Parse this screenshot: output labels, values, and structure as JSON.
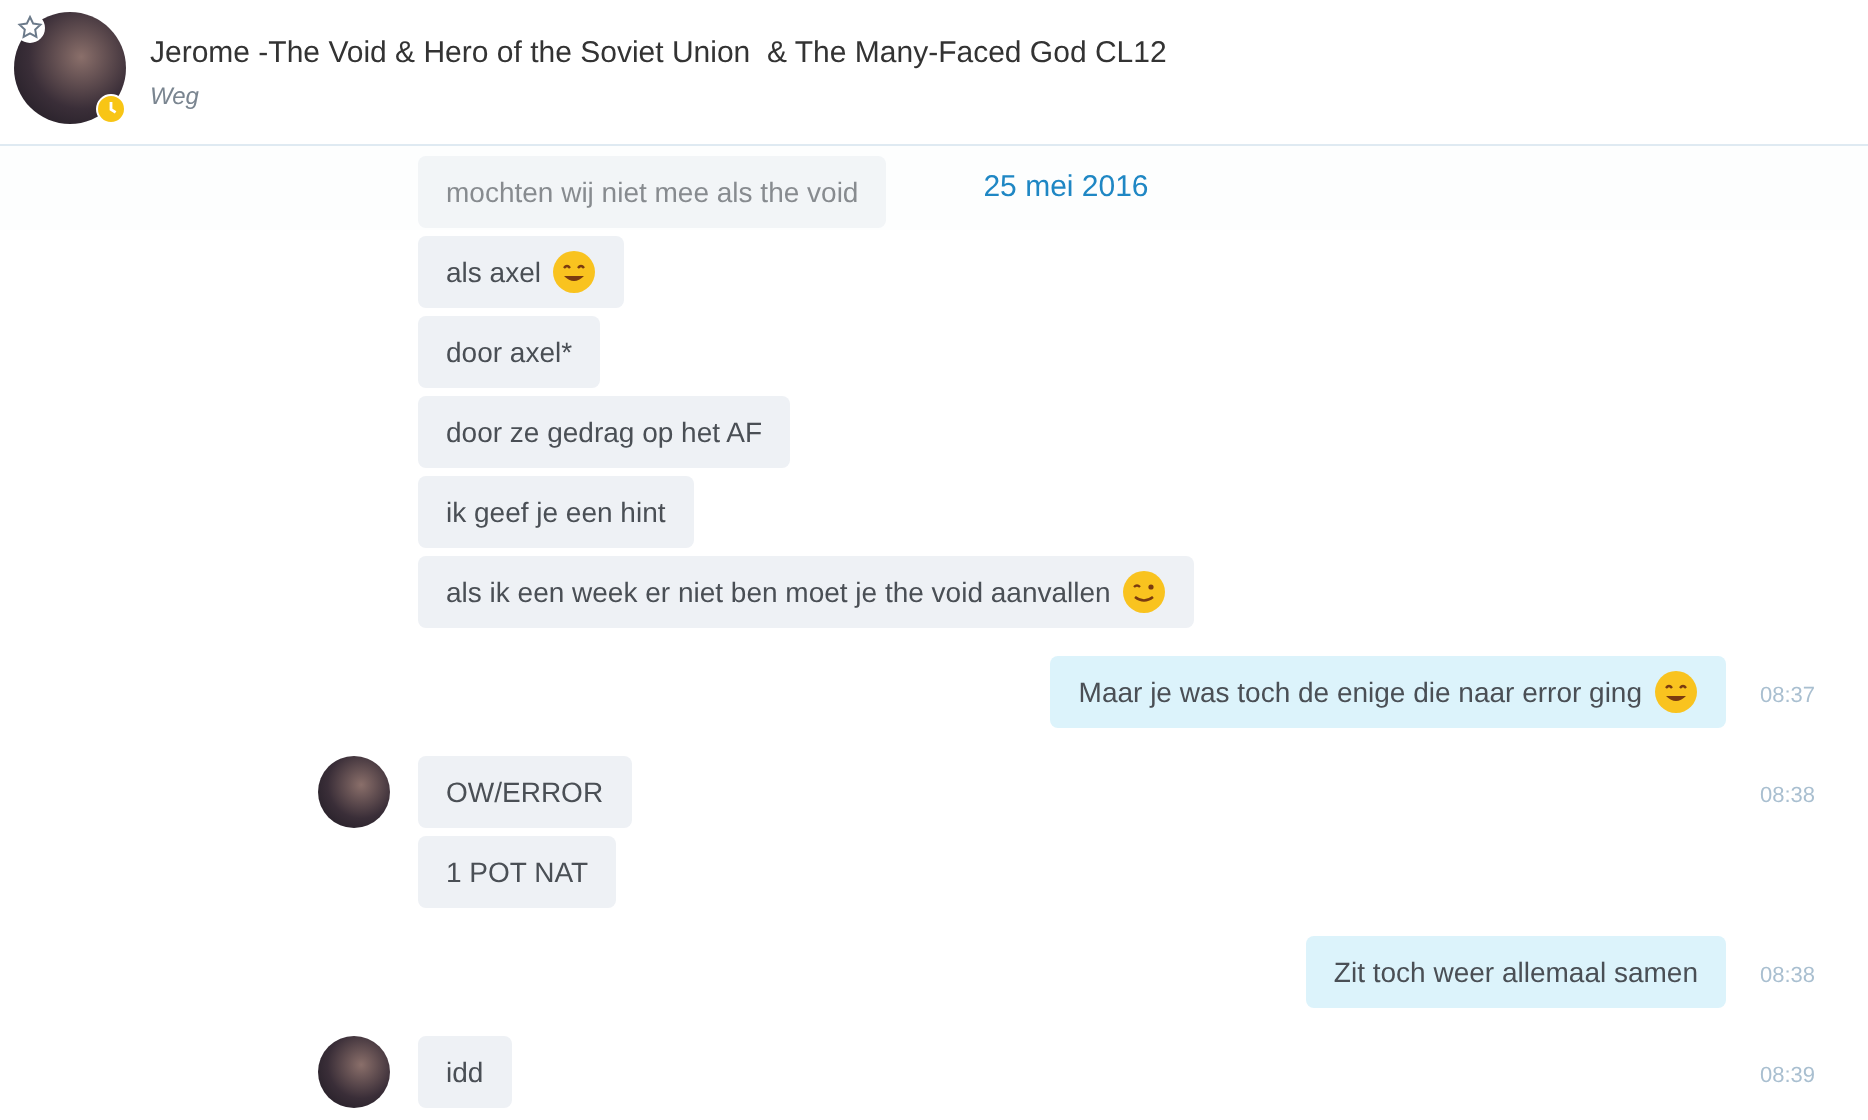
{
  "header": {
    "title": "Jerome -The Void & Hero of the Soviet Union  & The Many-Faced God CL12",
    "status": "Weg",
    "favorite": false,
    "away": true
  },
  "date_divider": "25 mei 2016",
  "messages": [
    {
      "kind": "incoming",
      "show_avatar": false,
      "bubbles": [
        {
          "kind": "plain",
          "text": "mochten wij niet mee als the void"
        },
        {
          "kind": "grin",
          "text": "als axel"
        },
        {
          "kind": "plain",
          "text": "door axel*"
        },
        {
          "kind": "plain",
          "text": "door ze gedrag op het AF"
        },
        {
          "kind": "plain",
          "text": "ik geef je een hint"
        },
        {
          "kind": "wink",
          "text": "als ik een week er niet ben moet je the void aanvallen"
        }
      ]
    },
    {
      "kind": "outgoing",
      "time": "08:37",
      "bubbles": [
        {
          "kind": "grin",
          "text": "Maar je was toch de enige die naar error ging"
        }
      ]
    },
    {
      "kind": "incoming",
      "show_avatar": true,
      "time": "08:38",
      "bubbles": [
        {
          "kind": "plain",
          "text": "OW/ERROR"
        },
        {
          "kind": "plain",
          "text": "1 POT NAT"
        }
      ]
    },
    {
      "kind": "outgoing",
      "time": "08:38",
      "bubbles": [
        {
          "kind": "plain",
          "text": "Zit toch weer allemaal samen"
        }
      ]
    },
    {
      "kind": "incoming",
      "show_avatar": true,
      "time": "08:39",
      "bubbles": [
        {
          "kind": "plain",
          "text": "idd"
        }
      ]
    }
  ]
}
